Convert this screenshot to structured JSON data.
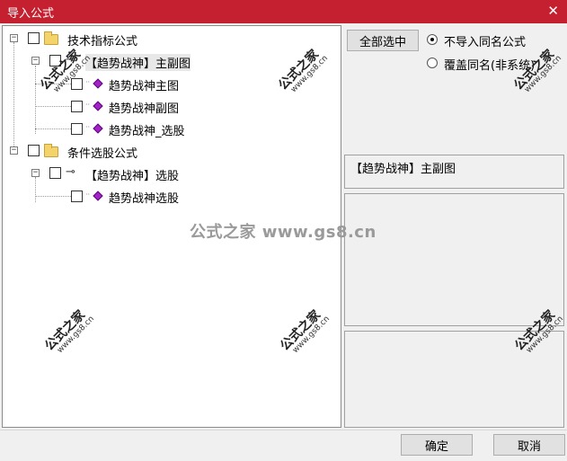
{
  "window": {
    "title": "导入公式",
    "close_glyph": "✕"
  },
  "tree": {
    "nodes": [
      {
        "label": "技术指标公式"
      },
      {
        "label": "【趋势战神】主副图"
      },
      {
        "label": "趋势战神主图"
      },
      {
        "label": "趋势战神副图"
      },
      {
        "label": "趋势战神_选股"
      },
      {
        "label": "条件选股公式"
      },
      {
        "label": "【趋势战神】选股"
      },
      {
        "label": "趋势战神选股"
      }
    ],
    "expander_glyph": "−"
  },
  "right": {
    "select_all_label": "全部选中",
    "radio_skip_label": "不导入同名公式",
    "radio_overwrite_label": "覆盖同名(非系统)",
    "radio_selected": "skip",
    "info_text": "【趋势战神】主副图"
  },
  "footer": {
    "ok_label": "确定",
    "cancel_label": "取消"
  },
  "watermark": {
    "text": "公式之家",
    "url": "www.gs8.cn",
    "center": "公式之家 www.gs8.cn"
  },
  "colors": {
    "titlebar": "#c4202f",
    "gem": "#a321c9",
    "folder": "#f5d36b"
  },
  "icons": {
    "folder": "folder-icon",
    "formula_group": "key-icon",
    "formula": "gem-icon"
  }
}
